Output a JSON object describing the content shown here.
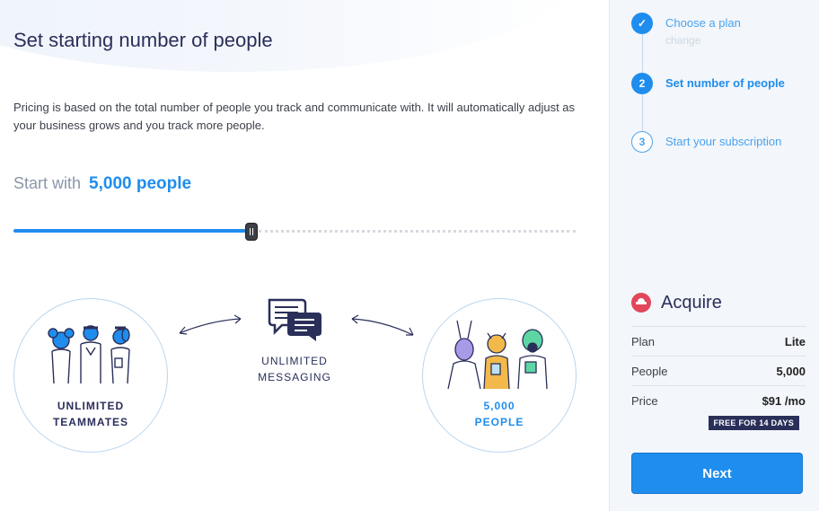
{
  "main": {
    "title": "Set starting number of people",
    "description": "Pricing is based on the total number of people you track and communicate with. It will automatically adjust as your business grows and you track more people.",
    "start_label": "Start with",
    "start_value": "5,000 people",
    "slider_fraction": 0.42,
    "teammates_line1": "UNLIMITED",
    "teammates_line2": "TEAMMATES",
    "messaging_line1": "UNLIMITED",
    "messaging_line2": "MESSAGING",
    "people_line1": "5,000",
    "people_line2": "PEOPLE"
  },
  "steps": [
    {
      "number": "✓",
      "label": "Choose a plan",
      "sub": "change"
    },
    {
      "number": "2",
      "label": "Set number of people"
    },
    {
      "number": "3",
      "label": "Start your subscription"
    }
  ],
  "summary": {
    "product": "Acquire",
    "rows": [
      {
        "key": "Plan",
        "value": "Lite"
      },
      {
        "key": "People",
        "value": "5,000"
      },
      {
        "key": "Price",
        "value": "$91 /mo"
      }
    ],
    "badge": "FREE FOR 14 DAYS",
    "next_label": "Next"
  },
  "colors": {
    "accent": "#1f8ded",
    "navy": "#2a2f5a",
    "acquire": "#e2465a"
  }
}
